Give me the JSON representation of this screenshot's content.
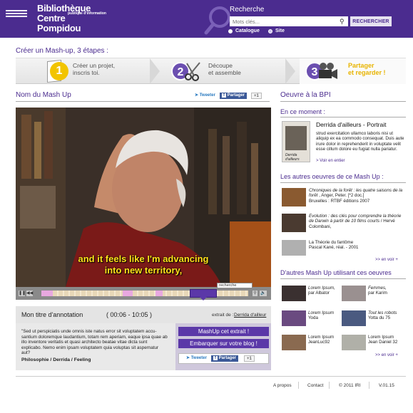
{
  "header": {
    "logo_line1": "Bibliothèque",
    "logo_line2": "Centre",
    "logo_line3": "Pompidou",
    "logo_sub": "publique d'information",
    "search_title": "Recherche",
    "search_placeholder": "Mots clés...",
    "search_button": "RECHERCHER",
    "radio_catalogue": "Catalogue",
    "radio_site": "Site"
  },
  "steps": {
    "title": "Créer un Mash-up, 3 étapes :",
    "items": [
      {
        "num": "1",
        "line1": "Créer un projet,",
        "line2": "inscris toi."
      },
      {
        "num": "2",
        "line1": "Découpe",
        "line2": "et assemble"
      },
      {
        "num": "3",
        "line1": "Partager",
        "line2": "et regarder !"
      }
    ]
  },
  "main": {
    "title": "Nom du Mash Up",
    "share": {
      "tweet": "Tweeter",
      "facebook": "Partager",
      "plusone": "+1"
    },
    "subtitle_line1": "and it feels like I'm advancing",
    "subtitle_line2": "into new territory,",
    "timeline_search": "recherche",
    "annotation": {
      "title": "Mon titre d'annotation",
      "time": "( 00:06 - 10:05 )",
      "extract_label": "extrait de :",
      "extract_link": "Derrida d'ailleur",
      "text": "\"Sed ut perspiciatis unde omnis iste natus error sit voluptatem accu-santium doloremque laudantium, totam rem aperiam, eaque ipsa quae ab illo inventore veritatis et quasi architecto beatae vitae dicta sunt explicabo. Nemo enim ipsam voluptatem quia voluptas sit aspernatur aut?",
      "tags": [
        "Philosophie",
        "Derrida",
        "Feeling"
      ],
      "mashup_button": "MashUp cet extrait !",
      "embed_button": "Embarquer sur votre blog !"
    }
  },
  "right": {
    "heading": "Oeuvre à la BPI",
    "now_heading": "En ce moment :",
    "now_title": "Derrida d'ailleurs - Portrait",
    "now_cover_text": "Derrida d'ailleurs",
    "now_text": "strud exercitation ullamco laboris nisi ut aliquip ex ea commodo consequat. Duis aute irure dolor in reprehenderit in voluptate velit esse cillum dolore eu fugiat nulla pariatur.",
    "now_more": "> Voir en entier",
    "others_heading": "Les autres oeuvres de ce Mash Up :",
    "others": [
      {
        "title": "Chroniques de la forêt : les quatre saisons de la forêt",
        "credit": ", Anger, Peter. [*2 doc.]",
        "extra": "Bruxelles : RTBF éditions 2007"
      },
      {
        "title": "Evolution : des clés pour comprendre la théorie de Darwin à partir de 10 films courts",
        "credit": "/ Hervé Colombani,"
      },
      {
        "title": "La Théorie du fantôme",
        "credit": "Pascal Kané, réal. - 2001"
      }
    ],
    "others_more": ">> en voir +",
    "mashups_heading": "D'autres Mash Up utilisant ces oeuvres",
    "mashups": [
      {
        "title": "Lorem Ipsum,",
        "by": "par",
        "author": "Albator"
      },
      {
        "title": "Femmes,",
        "by": "par",
        "author": "Karim"
      },
      {
        "title": "Lorem Ipsum",
        "by": "",
        "author": "Yoda"
      },
      {
        "title": "Tout les robots",
        "by": "",
        "author": "Yotta du 75"
      },
      {
        "title": "Lorem Ipsum",
        "by": "",
        "author": "JeanLuc92"
      },
      {
        "title": "Lorem Ipsum",
        "by": "",
        "author": "Jean Daniel 32"
      }
    ],
    "mashups_more": ">> en voir +"
  },
  "footer": {
    "apropos": "A propos",
    "contact": "Contact",
    "copyright": "© 2011 IRI",
    "version": "V.01.15"
  },
  "colors": {
    "brand": "#4b2c8f",
    "accent_button": "#5b38a8",
    "subtitle": "#ffe11a",
    "step3_highlight": "#ffd21a"
  }
}
